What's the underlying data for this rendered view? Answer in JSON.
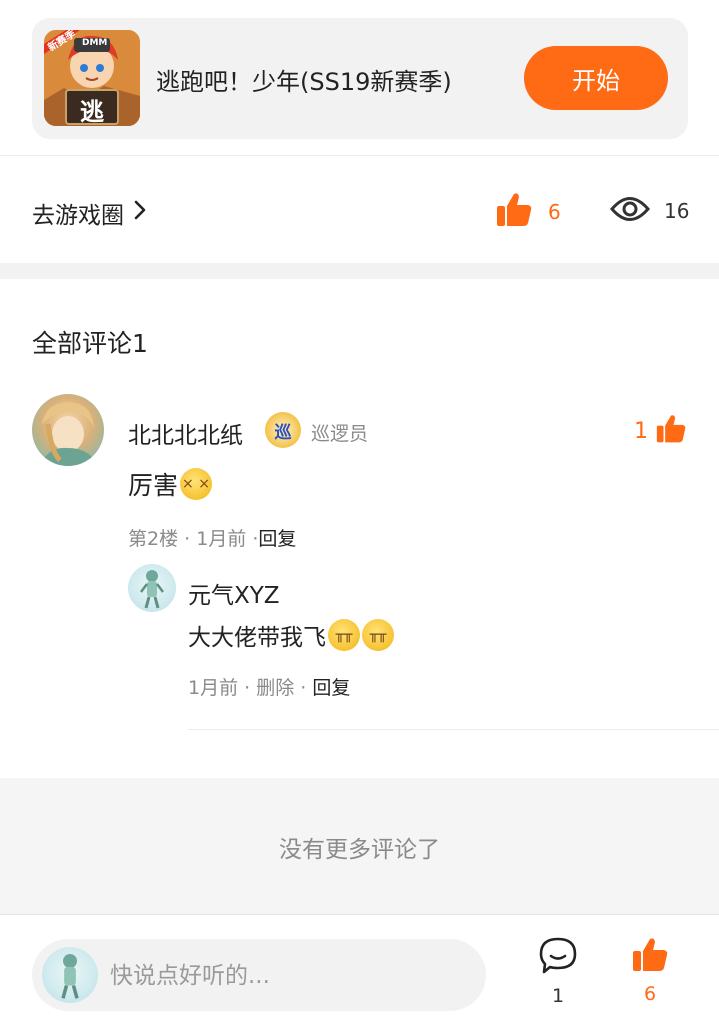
{
  "game": {
    "title": "逃跑吧！少年(SS19新赛季)",
    "icon_badge": "新赛季",
    "icon_char": "逃",
    "icon_brand": "DMM",
    "start_label": "开始"
  },
  "meta": {
    "go_circle_label": "去游戏圈",
    "likes": "6",
    "views": "16"
  },
  "comments": {
    "section_title": "全部评论1",
    "items": [
      {
        "user": "北北北北纸",
        "badge_char": "巡",
        "badge_label": "巡逻员",
        "likes": "1",
        "text": "厉害",
        "floor": "第2楼",
        "time": "1月前",
        "reply_label": "回复",
        "replies": [
          {
            "user": "元气XYZ",
            "text": "大大佬带我飞",
            "time": "1月前",
            "delete_label": "删除",
            "reply_label": "回复"
          }
        ]
      }
    ]
  },
  "no_more": "没有更多评论了",
  "bottom_bar": {
    "input_placeholder": "快说点好听的...",
    "comment_count": "1",
    "like_count": "6"
  },
  "colors": {
    "accent": "#ff6a14",
    "muted": "#8a8a8a",
    "band": "#f2f2f2"
  }
}
